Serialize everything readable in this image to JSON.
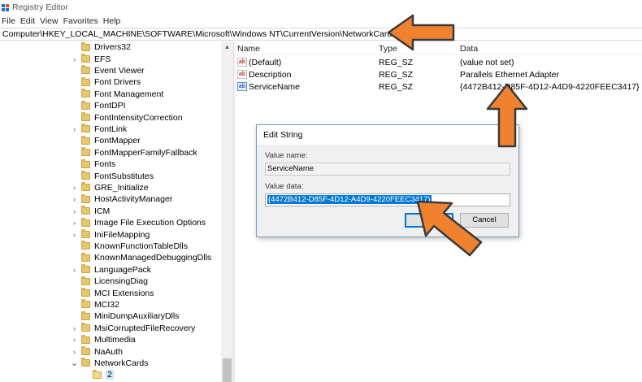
{
  "window": {
    "title": "Registry Editor"
  },
  "menu": [
    "File",
    "Edit",
    "View",
    "Favorites",
    "Help"
  ],
  "address": "Computer\\HKEY_LOCAL_MACHINE\\SOFTWARE\\Microsoft\\Windows NT\\CurrentVersion\\NetworkCards\\2",
  "tree": {
    "items": [
      {
        "label": "Drivers32",
        "expandable": false
      },
      {
        "label": "EFS",
        "expandable": true
      },
      {
        "label": "Event Viewer",
        "expandable": false
      },
      {
        "label": "Font Drivers",
        "expandable": false
      },
      {
        "label": "Font Management",
        "expandable": false
      },
      {
        "label": "FontDPI",
        "expandable": false
      },
      {
        "label": "FontIntensityCorrection",
        "expandable": false
      },
      {
        "label": "FontLink",
        "expandable": true
      },
      {
        "label": "FontMapper",
        "expandable": false
      },
      {
        "label": "FontMapperFamilyFallback",
        "expandable": false
      },
      {
        "label": "Fonts",
        "expandable": false
      },
      {
        "label": "FontSubstitutes",
        "expandable": false
      },
      {
        "label": "GRE_Initialize",
        "expandable": true
      },
      {
        "label": "HostActivityManager",
        "expandable": true
      },
      {
        "label": "ICM",
        "expandable": true
      },
      {
        "label": "Image File Execution Options",
        "expandable": true
      },
      {
        "label": "IniFileMapping",
        "expandable": true
      },
      {
        "label": "KnownFunctionTableDlls",
        "expandable": false
      },
      {
        "label": "KnownManagedDebuggingDlls",
        "expandable": false
      },
      {
        "label": "LanguagePack",
        "expandable": true
      },
      {
        "label": "LicensingDiag",
        "expandable": false
      },
      {
        "label": "MCI Extensions",
        "expandable": false
      },
      {
        "label": "MCI32",
        "expandable": false
      },
      {
        "label": "MiniDumpAuxiliaryDlls",
        "expandable": false
      },
      {
        "label": "MsiCorruptedFileRecovery",
        "expandable": true
      },
      {
        "label": "Multimedia",
        "expandable": true
      },
      {
        "label": "NaAuth",
        "expandable": true
      },
      {
        "label": "NetworkCards",
        "expandable": true,
        "expanded": true
      }
    ],
    "selected_child": "2"
  },
  "list": {
    "headers": {
      "name": "Name",
      "type": "Type",
      "data": "Data"
    },
    "rows": [
      {
        "icon": "string-value-icon",
        "name": "(Default)",
        "type": "REG_SZ",
        "data": "(value not set)"
      },
      {
        "icon": "string-value-icon",
        "name": "Description",
        "type": "REG_SZ",
        "data": "Parallels Ethernet Adapter"
      },
      {
        "icon": "string-value-icon",
        "name": "ServiceName",
        "type": "REG_SZ",
        "data": "{4472B412-D85F-4D12-A4D9-4220FEEC3417}"
      }
    ]
  },
  "dialog": {
    "title": "Edit String",
    "value_name_label": "Value name:",
    "value_name": "ServiceName",
    "value_data_label": "Value data:",
    "value_data": "{4472B412-D85F-4D12-A4D9-4220FEEC3417}",
    "ok_label": "OK",
    "cancel_label": "Cancel"
  },
  "colors": {
    "arrow_fill": "#f0822f",
    "arrow_stroke": "#3a3a3a",
    "selection": "#0078d7",
    "folder": "#e8c76a"
  }
}
